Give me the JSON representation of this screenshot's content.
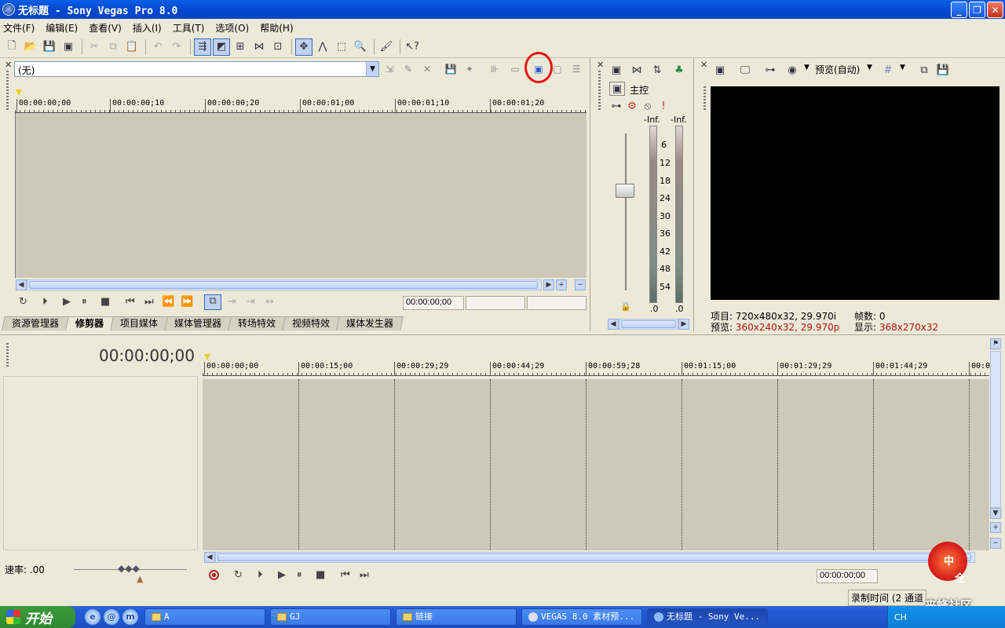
{
  "window": {
    "title": "无标题 - Sony Vegas Pro 8.0"
  },
  "menu": [
    "文件(F)",
    "编辑(E)",
    "查看(V)",
    "插入(I)",
    "工具(T)",
    "选项(O)",
    "帮助(H)"
  ],
  "trimmer": {
    "source": "(无)",
    "ruler": [
      "00:00:00;00",
      "00:00:00;10",
      "00:00:00;20",
      "00:00:01;00",
      "00:00:01;10",
      "00:00:01;20"
    ],
    "timecode": "00:00:00;00"
  },
  "tabs": [
    "资源管理器",
    "修剪器",
    "项目媒体",
    "媒体管理器",
    "转场特效",
    "视频特效",
    "媒体发生器"
  ],
  "active_tab": "修剪器",
  "mixer": {
    "master_label": "主控",
    "peak_left": "-Inf.",
    "peak_right": "-Inf.",
    "scale": [
      "6",
      "12",
      "18",
      "24",
      "30",
      "36",
      "42",
      "48",
      "54"
    ],
    "bottom_left": ".0",
    "bottom_right": ".0"
  },
  "preview": {
    "quality": "预览(自动)",
    "project_label": "项目:",
    "project_value": "720x480x32, 29.970i",
    "preview_label": "预览:",
    "preview_value": "360x240x32, 29.970p",
    "frames_label": "帧数:",
    "frames_value": "0",
    "display_label": "显示:",
    "display_value": "368x270x32"
  },
  "timeline": {
    "current_time": "00:00:00;00",
    "ruler": [
      "00:00:00;00",
      "00:00:15;00",
      "00:00:29;29",
      "00:00:44;29",
      "00:00:59;28",
      "00:01:15;00",
      "00:01:29;29",
      "00:01:44;29",
      "00:0"
    ],
    "rate_label": "速率: .00",
    "timecode": "00:00:00;00",
    "record_time": "录制时间 (2 通道"
  },
  "taskbar": {
    "start": "开始",
    "tasks": [
      "A",
      "GJ",
      "链接",
      "VEGAS 8.0 素材预...",
      "无标题 - Sony Ve..."
    ],
    "tray_lang": "CH"
  },
  "watermark": {
    "line1": "中",
    "line2": "全",
    "site": "来蜂社区"
  },
  "colors": {
    "chrome": "#ece9d8",
    "workarea": "#cdc9b9",
    "xp_blue": "#0a5ee6",
    "annotation_red": "#ee1111",
    "info_red": "#b0170c"
  }
}
